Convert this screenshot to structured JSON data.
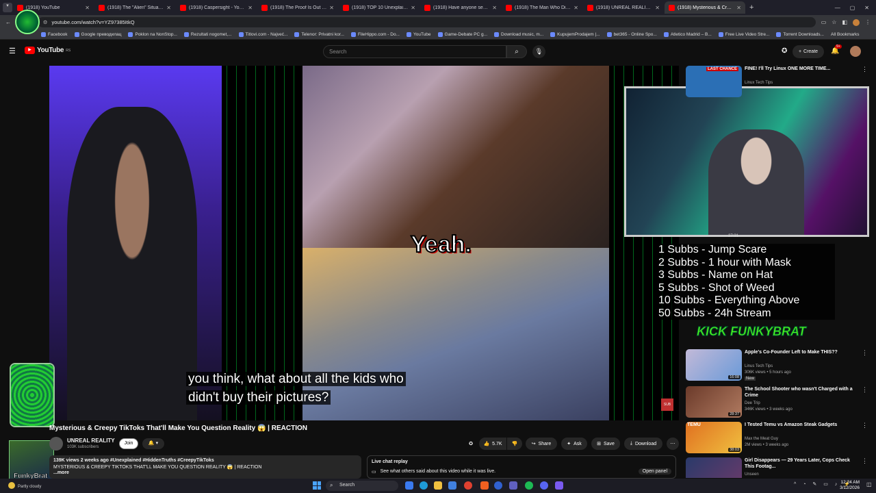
{
  "browser": {
    "tabs": [
      {
        "title": "(1918) YouTube"
      },
      {
        "title": "(1918) The \"Alien\" Situation Is U"
      },
      {
        "title": "(1918) Caspersight - YouTube"
      },
      {
        "title": "(1918) The Proof Is Out There"
      },
      {
        "title": "(1918) TOP 10 Unexplained Pho"
      },
      {
        "title": "(1918) Have anyone seen this v"
      },
      {
        "title": "(1918) The Man Who Disappea"
      },
      {
        "title": "(1918) UNREAL REALITY - YouT"
      },
      {
        "title": "(1918) Mysterious & Creep"
      }
    ],
    "new_tab": "+",
    "url": "youtube.com/watch?v=YZ97385ItkQ",
    "bookmarks": [
      "Facebook",
      "Google преводилац",
      "Poklon na NonStop...",
      "Rezultati nogomet,...",
      "Titlovi.com - Najveć...",
      "Telenor: Privatni kor...",
      "FileHippo.com - Do...",
      "YouTube",
      "Game-Debate PC g...",
      "Download music, m...",
      "KupujemProdajem |...",
      "bet365 - Online Spo...",
      "Atletico Madrid – B...",
      "Free Live Video Stre...",
      "Torrent Downloads..."
    ],
    "all_bookmarks": "All Bookmarks"
  },
  "youtube": {
    "logo": "YouTube",
    "region": "RS",
    "search_placeholder": "Search",
    "create_label": "Create",
    "notif_badge": "9+"
  },
  "video": {
    "caption_line1": "you think, what about all the kids who",
    "caption_line2": "didn't buy their pictures?",
    "overlay_text": "Yeah.",
    "title": "Mysterious & Creepy TikToks That'll Make You Question Reality 😱 | REACTION",
    "channel": "UNREAL REALITY",
    "subscribers": "103K subscribers",
    "join_label": "Join",
    "likes": "5.7K",
    "share_label": "Share",
    "ask_label": "Ask",
    "save_label": "Save",
    "download_label": "Download",
    "views_line": "139K views  2 weeks ago  #Unexplained #HiddenTruths #CreepyTikToks",
    "desc_line": "MYSTERIOUS & CREEPY TIKTOKS THAT'LL MAKE YOU QUESTION REALITY 😱 | REACTION",
    "more_label": "...more",
    "chat_title": "Live chat replay",
    "chat_desc": "See what others said about this video while it was live.",
    "open_panel": "Open panel"
  },
  "stream_overlay": {
    "timer": "27:31",
    "subs_goals": [
      "1 Subbs - Jump Scare",
      "2 Subbs - 1 hour with Mask",
      "3 Subbs - Name on Hat",
      "5 Subbs - Shot of Weed",
      "10 Subbs - Everything Above",
      "50 Subbs - 24h Stream"
    ],
    "brand": "KICK FUNKYBRAT",
    "streamer_name": "FunkyBrat"
  },
  "sidebar": {
    "recommendations": [
      {
        "title": "FINE! I'll Try Linux ONE MORE TIME...",
        "channel": "Linux Tech Tips",
        "meta": "",
        "thumb_color": "#2b6fb5",
        "badge": "LAST CHANCE"
      },
      {
        "title": "Apple's Co-Founder Left to Make THIS??",
        "channel": "Linus Tech Tips",
        "meta": "306K views • 5 hours ago",
        "badge": "New",
        "duration": "16:08",
        "thumb_color": "#c2b9d8"
      },
      {
        "title": "The School Shooter who wasn't Charged with a Crime",
        "channel": "Dee Trip",
        "meta": "346K views • 3 weeks ago",
        "duration": "28:37",
        "thumb_color": "#6b3a2a"
      },
      {
        "title": "I Tested Temu vs Amazon Steak Gadgets",
        "channel": "Max the Meat Guy",
        "meta": "2M views • 3 weeks ago",
        "duration": "38:03",
        "thumb_color": "#e07020",
        "badge": "TEMU"
      },
      {
        "title": "Girl Disappears — 29 Years Later, Cops Check This Footag...",
        "channel": "Unseen",
        "meta": "",
        "thumb_color": "#2a3a6a"
      }
    ]
  },
  "taskbar": {
    "weather": "Partly cloudy",
    "search": "Search",
    "time": "12:24 AM",
    "date": "3/12/2026"
  }
}
